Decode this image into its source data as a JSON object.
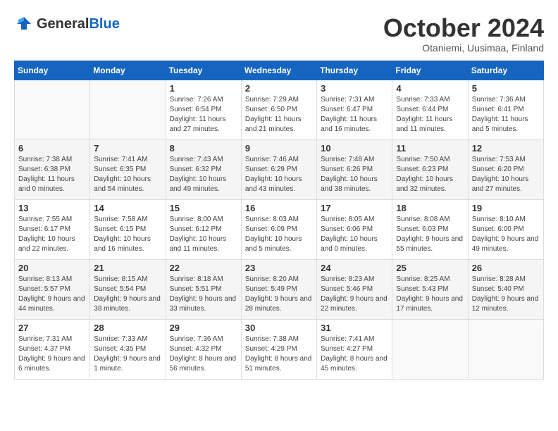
{
  "header": {
    "logo_general": "General",
    "logo_blue": "Blue",
    "month_title": "October 2024",
    "subtitle": "Otaniemi, Uusimaa, Finland"
  },
  "days_of_week": [
    "Sunday",
    "Monday",
    "Tuesday",
    "Wednesday",
    "Thursday",
    "Friday",
    "Saturday"
  ],
  "weeks": [
    [
      {
        "day": "",
        "info": ""
      },
      {
        "day": "",
        "info": ""
      },
      {
        "day": "1",
        "sunrise": "Sunrise: 7:26 AM",
        "sunset": "Sunset: 6:54 PM",
        "daylight": "Daylight: 11 hours and 27 minutes."
      },
      {
        "day": "2",
        "sunrise": "Sunrise: 7:29 AM",
        "sunset": "Sunset: 6:50 PM",
        "daylight": "Daylight: 11 hours and 21 minutes."
      },
      {
        "day": "3",
        "sunrise": "Sunrise: 7:31 AM",
        "sunset": "Sunset: 6:47 PM",
        "daylight": "Daylight: 11 hours and 16 minutes."
      },
      {
        "day": "4",
        "sunrise": "Sunrise: 7:33 AM",
        "sunset": "Sunset: 6:44 PM",
        "daylight": "Daylight: 11 hours and 11 minutes."
      },
      {
        "day": "5",
        "sunrise": "Sunrise: 7:36 AM",
        "sunset": "Sunset: 6:41 PM",
        "daylight": "Daylight: 11 hours and 5 minutes."
      }
    ],
    [
      {
        "day": "6",
        "sunrise": "Sunrise: 7:38 AM",
        "sunset": "Sunset: 6:38 PM",
        "daylight": "Daylight: 11 hours and 0 minutes."
      },
      {
        "day": "7",
        "sunrise": "Sunrise: 7:41 AM",
        "sunset": "Sunset: 6:35 PM",
        "daylight": "Daylight: 10 hours and 54 minutes."
      },
      {
        "day": "8",
        "sunrise": "Sunrise: 7:43 AM",
        "sunset": "Sunset: 6:32 PM",
        "daylight": "Daylight: 10 hours and 49 minutes."
      },
      {
        "day": "9",
        "sunrise": "Sunrise: 7:46 AM",
        "sunset": "Sunset: 6:29 PM",
        "daylight": "Daylight: 10 hours and 43 minutes."
      },
      {
        "day": "10",
        "sunrise": "Sunrise: 7:48 AM",
        "sunset": "Sunset: 6:26 PM",
        "daylight": "Daylight: 10 hours and 38 minutes."
      },
      {
        "day": "11",
        "sunrise": "Sunrise: 7:50 AM",
        "sunset": "Sunset: 6:23 PM",
        "daylight": "Daylight: 10 hours and 32 minutes."
      },
      {
        "day": "12",
        "sunrise": "Sunrise: 7:53 AM",
        "sunset": "Sunset: 6:20 PM",
        "daylight": "Daylight: 10 hours and 27 minutes."
      }
    ],
    [
      {
        "day": "13",
        "sunrise": "Sunrise: 7:55 AM",
        "sunset": "Sunset: 6:17 PM",
        "daylight": "Daylight: 10 hours and 22 minutes."
      },
      {
        "day": "14",
        "sunrise": "Sunrise: 7:58 AM",
        "sunset": "Sunset: 6:15 PM",
        "daylight": "Daylight: 10 hours and 16 minutes."
      },
      {
        "day": "15",
        "sunrise": "Sunrise: 8:00 AM",
        "sunset": "Sunset: 6:12 PM",
        "daylight": "Daylight: 10 hours and 11 minutes."
      },
      {
        "day": "16",
        "sunrise": "Sunrise: 8:03 AM",
        "sunset": "Sunset: 6:09 PM",
        "daylight": "Daylight: 10 hours and 5 minutes."
      },
      {
        "day": "17",
        "sunrise": "Sunrise: 8:05 AM",
        "sunset": "Sunset: 6:06 PM",
        "daylight": "Daylight: 10 hours and 0 minutes."
      },
      {
        "day": "18",
        "sunrise": "Sunrise: 8:08 AM",
        "sunset": "Sunset: 6:03 PM",
        "daylight": "Daylight: 9 hours and 55 minutes."
      },
      {
        "day": "19",
        "sunrise": "Sunrise: 8:10 AM",
        "sunset": "Sunset: 6:00 PM",
        "daylight": "Daylight: 9 hours and 49 minutes."
      }
    ],
    [
      {
        "day": "20",
        "sunrise": "Sunrise: 8:13 AM",
        "sunset": "Sunset: 5:57 PM",
        "daylight": "Daylight: 9 hours and 44 minutes."
      },
      {
        "day": "21",
        "sunrise": "Sunrise: 8:15 AM",
        "sunset": "Sunset: 5:54 PM",
        "daylight": "Daylight: 9 hours and 38 minutes."
      },
      {
        "day": "22",
        "sunrise": "Sunrise: 8:18 AM",
        "sunset": "Sunset: 5:51 PM",
        "daylight": "Daylight: 9 hours and 33 minutes."
      },
      {
        "day": "23",
        "sunrise": "Sunrise: 8:20 AM",
        "sunset": "Sunset: 5:49 PM",
        "daylight": "Daylight: 9 hours and 28 minutes."
      },
      {
        "day": "24",
        "sunrise": "Sunrise: 8:23 AM",
        "sunset": "Sunset: 5:46 PM",
        "daylight": "Daylight: 9 hours and 22 minutes."
      },
      {
        "day": "25",
        "sunrise": "Sunrise: 8:25 AM",
        "sunset": "Sunset: 5:43 PM",
        "daylight": "Daylight: 9 hours and 17 minutes."
      },
      {
        "day": "26",
        "sunrise": "Sunrise: 8:28 AM",
        "sunset": "Sunset: 5:40 PM",
        "daylight": "Daylight: 9 hours and 12 minutes."
      }
    ],
    [
      {
        "day": "27",
        "sunrise": "Sunrise: 7:31 AM",
        "sunset": "Sunset: 4:37 PM",
        "daylight": "Daylight: 9 hours and 6 minutes."
      },
      {
        "day": "28",
        "sunrise": "Sunrise: 7:33 AM",
        "sunset": "Sunset: 4:35 PM",
        "daylight": "Daylight: 9 hours and 1 minute."
      },
      {
        "day": "29",
        "sunrise": "Sunrise: 7:36 AM",
        "sunset": "Sunset: 4:32 PM",
        "daylight": "Daylight: 8 hours and 56 minutes."
      },
      {
        "day": "30",
        "sunrise": "Sunrise: 7:38 AM",
        "sunset": "Sunset: 4:29 PM",
        "daylight": "Daylight: 8 hours and 51 minutes."
      },
      {
        "day": "31",
        "sunrise": "Sunrise: 7:41 AM",
        "sunset": "Sunset: 4:27 PM",
        "daylight": "Daylight: 8 hours and 45 minutes."
      },
      {
        "day": "",
        "info": ""
      },
      {
        "day": "",
        "info": ""
      }
    ]
  ]
}
